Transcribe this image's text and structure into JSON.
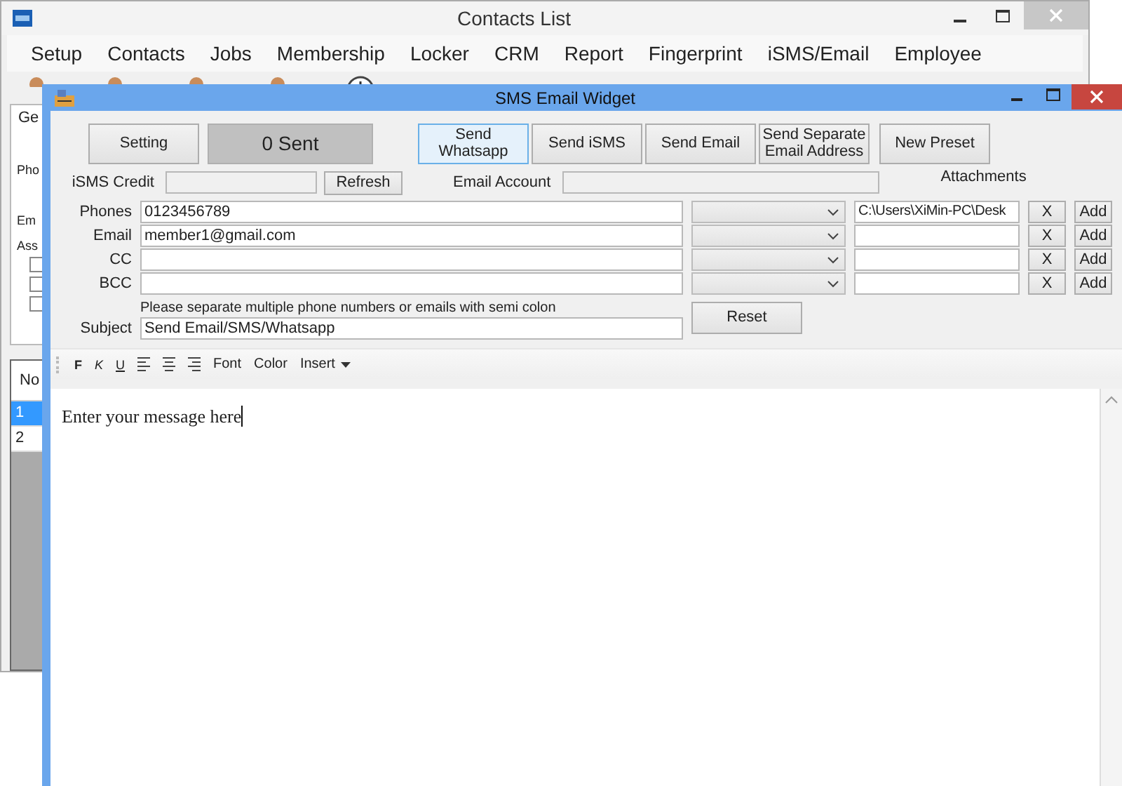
{
  "background_window": {
    "title": "Contacts List",
    "menu": [
      "Setup",
      "Contacts",
      "Jobs",
      "Membership",
      "Locker",
      "CRM",
      "Report",
      "Fingerprint",
      "iSMS/Email",
      "Employee"
    ],
    "panel": {
      "tab": "Ge",
      "labels": [
        "Pho",
        "Em",
        "Ass"
      ],
      "checkboxes": [
        {
          "checked": false
        },
        {
          "checked": false
        },
        {
          "checked": false
        }
      ]
    },
    "table": {
      "columns": [
        "No"
      ],
      "rows": [
        {
          "cells": [
            "1"
          ],
          "selected": true
        },
        {
          "cells": [
            "2"
          ],
          "selected": false
        }
      ]
    }
  },
  "window": {
    "title": "SMS Email Widget"
  },
  "top_buttons": [
    {
      "kind": "button",
      "label": "Setting",
      "focused": false
    },
    {
      "kind": "counter",
      "label": "0 Sent"
    },
    {
      "kind": "button",
      "label": "Send Whatsapp",
      "focused": true
    },
    {
      "kind": "button",
      "label": "Send iSMS",
      "focused": false
    },
    {
      "kind": "button",
      "label": "Send Email",
      "focused": false
    },
    {
      "kind": "button",
      "label": "Send Separate Email Address",
      "focused": false
    },
    {
      "kind": "button",
      "label": "New Preset",
      "focused": false
    }
  ],
  "credit_row": {
    "isms_credit_label": "iSMS Credit",
    "refresh": "Refresh",
    "email_account_label": "Email Account",
    "attachments_label": "Attachments"
  },
  "recipients": [
    {
      "label": "Phones",
      "value": "0123456789",
      "attachment": "C:\\Users\\XiMin-PC\\Desk",
      "remove": "X",
      "add": "Add"
    },
    {
      "label": "Email",
      "value": "member1@gmail.com",
      "remove": "X",
      "add": "Add"
    },
    {
      "label": "CC",
      "remove": "X",
      "add": "Add"
    },
    {
      "label": "BCC",
      "remove": "X",
      "add": "Add"
    }
  ],
  "hint": "Please separate multiple phone numbers or emails with semi colon",
  "subject": {
    "label": "Subject",
    "value": "Send Email/SMS/Whatsapp"
  },
  "reset": "Reset",
  "format_toolbar": [
    {
      "kind": "bold",
      "label": "F"
    },
    {
      "kind": "italic",
      "label": "K"
    },
    {
      "kind": "underline",
      "label": "U"
    },
    {
      "kind": "align-left"
    },
    {
      "kind": "align-center"
    },
    {
      "kind": "align-right"
    },
    {
      "kind": "menu",
      "label": "Font"
    },
    {
      "kind": "menu",
      "label": "Color"
    },
    {
      "kind": "dropdown",
      "label": "Insert"
    }
  ],
  "editor": {
    "text": "Enter your message here"
  }
}
